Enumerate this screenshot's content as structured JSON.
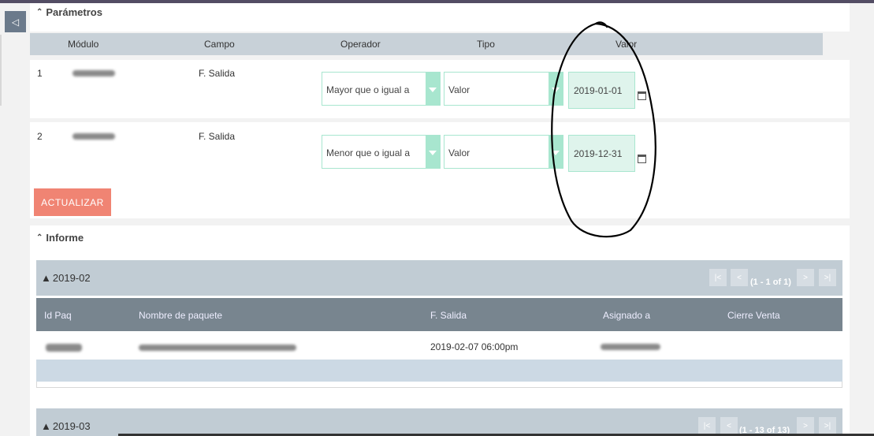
{
  "sidebar_toggle": {
    "icon": "collapse-left-icon",
    "glyph": "◁"
  },
  "parametros": {
    "title": "Parámetros",
    "chevron_glyph": "≈",
    "columns": [
      "Módulo",
      "Campo",
      "Operador",
      "Tipo",
      "Valor"
    ],
    "rows": [
      {
        "num": "1",
        "campo": "F. Salida",
        "operador": "Mayor que o igual a",
        "tipo": "Valor",
        "valor": "2019-01-01"
      },
      {
        "num": "2",
        "campo": "F. Salida",
        "operador": "Menor que o igual a",
        "tipo": "Valor",
        "valor": "2019-12-31"
      }
    ]
  },
  "actualizar_label": "ACTUALIZAR",
  "informe": {
    "title": "Informe",
    "groups": [
      {
        "label": "2019-02",
        "pager": "(1 - 1 of 1)"
      },
      {
        "label": "2019-03",
        "pager": "(1 - 13 of 13)"
      }
    ],
    "columns": [
      "Id Paq",
      "Nombre de paquete",
      "F. Salida",
      "Asignado a",
      "Cierre Venta"
    ],
    "rows": [
      {
        "f_salida": "2019-02-07 06:00pm"
      }
    ],
    "pager_glyphs": {
      "first": "|<",
      "prev": "<",
      "next": ">",
      "last": ">|"
    }
  },
  "colors": {
    "accent": "#f08473",
    "select_border": "#a8e6cf",
    "header_bg": "#c8d1d8",
    "table_head_bg": "#78858f"
  }
}
